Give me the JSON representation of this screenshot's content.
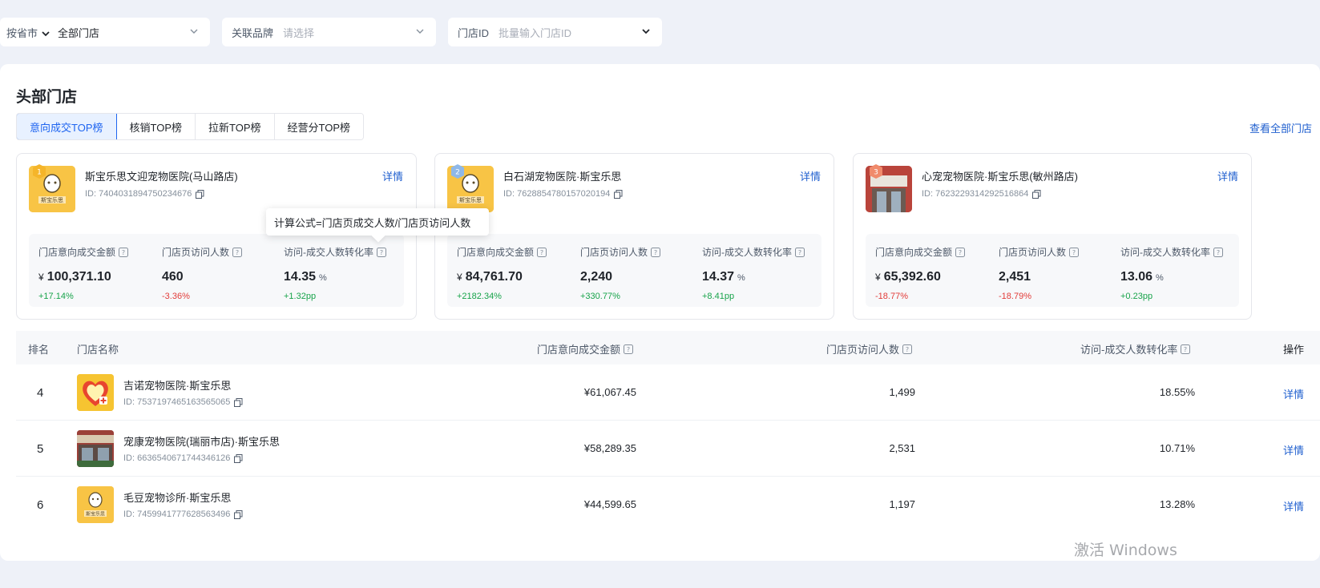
{
  "filters": {
    "region_label": "按省市",
    "store_value": "全部门店",
    "brand_label": "关联品牌",
    "brand_placeholder": "请选择",
    "storeid_label": "门店ID",
    "storeid_placeholder": "批量输入门店ID"
  },
  "section": {
    "title": "头部门店",
    "view_all": "查看全部门店",
    "tabs": [
      {
        "label": "意向成交TOP榜",
        "active": true
      },
      {
        "label": "核销TOP榜",
        "active": false
      },
      {
        "label": "拉新TOP榜",
        "active": false
      },
      {
        "label": "经营分TOP榜",
        "active": false
      }
    ]
  },
  "tooltip": "计算公式=门店页成交人数/门店页访问人数",
  "metric_labels": {
    "amount": "门店意向成交金额",
    "visitors": "门店页访问人数",
    "conversion": "访问-成交人数转化率",
    "currency": "¥",
    "percent_unit": "%"
  },
  "top_stores": [
    {
      "rank": "1",
      "name": "斯宝乐思文迎宠物医院(马山路店)",
      "id": "ID: 7404031894750234676",
      "detail": "详情",
      "amount": "100,371.10",
      "amount_delta": "+17.14%",
      "visitors": "460",
      "visitors_delta": "-3.36%",
      "conversion": "14.35",
      "conversion_delta": "+1.32pp"
    },
    {
      "rank": "2",
      "name": "白石湖宠物医院·斯宝乐思",
      "id": "ID: 7628854780157020194",
      "detail": "详情",
      "amount": "84,761.70",
      "amount_delta": "+2182.34%",
      "visitors": "2,240",
      "visitors_delta": "+330.77%",
      "conversion": "14.37",
      "conversion_delta": "+8.41pp"
    },
    {
      "rank": "3",
      "name": "心宠宠物医院·斯宝乐思(敏州路店)",
      "id": "ID: 7623229314292516864",
      "detail": "详情",
      "amount": "65,392.60",
      "amount_delta": "-18.77%",
      "visitors": "2,451",
      "visitors_delta": "-18.79%",
      "conversion": "13.06",
      "conversion_delta": "+0.23pp"
    }
  ],
  "table": {
    "headers": {
      "rank": "排名",
      "name": "门店名称",
      "amount": "门店意向成交金额",
      "visitors": "门店页访问人数",
      "conversion": "访问-成交人数转化率",
      "action": "操作"
    },
    "rows": [
      {
        "rank": "4",
        "name": "吉诺宠物医院·斯宝乐思",
        "id": "ID: 7537197465163565065",
        "amount": "¥61,067.45",
        "visitors": "1,499",
        "conversion": "18.55%",
        "action": "详情"
      },
      {
        "rank": "5",
        "name": "宠康宠物医院(瑞丽市店)·斯宝乐思",
        "id": "ID: 6636540671744346126",
        "amount": "¥58,289.35",
        "visitors": "2,531",
        "conversion": "10.71%",
        "action": "详情"
      },
      {
        "rank": "6",
        "name": "毛豆宠物诊所·斯宝乐思",
        "id": "ID: 7459941777628563496",
        "amount": "¥44,599.65",
        "visitors": "1,197",
        "conversion": "13.28%",
        "action": "详情"
      }
    ]
  },
  "watermark": "激活 Windows",
  "colors": {
    "accent": "#1f65f0",
    "link": "#1f5fcf",
    "up": "#17a34a",
    "down": "#e23c39",
    "logo_yellow": "#f8c445"
  }
}
